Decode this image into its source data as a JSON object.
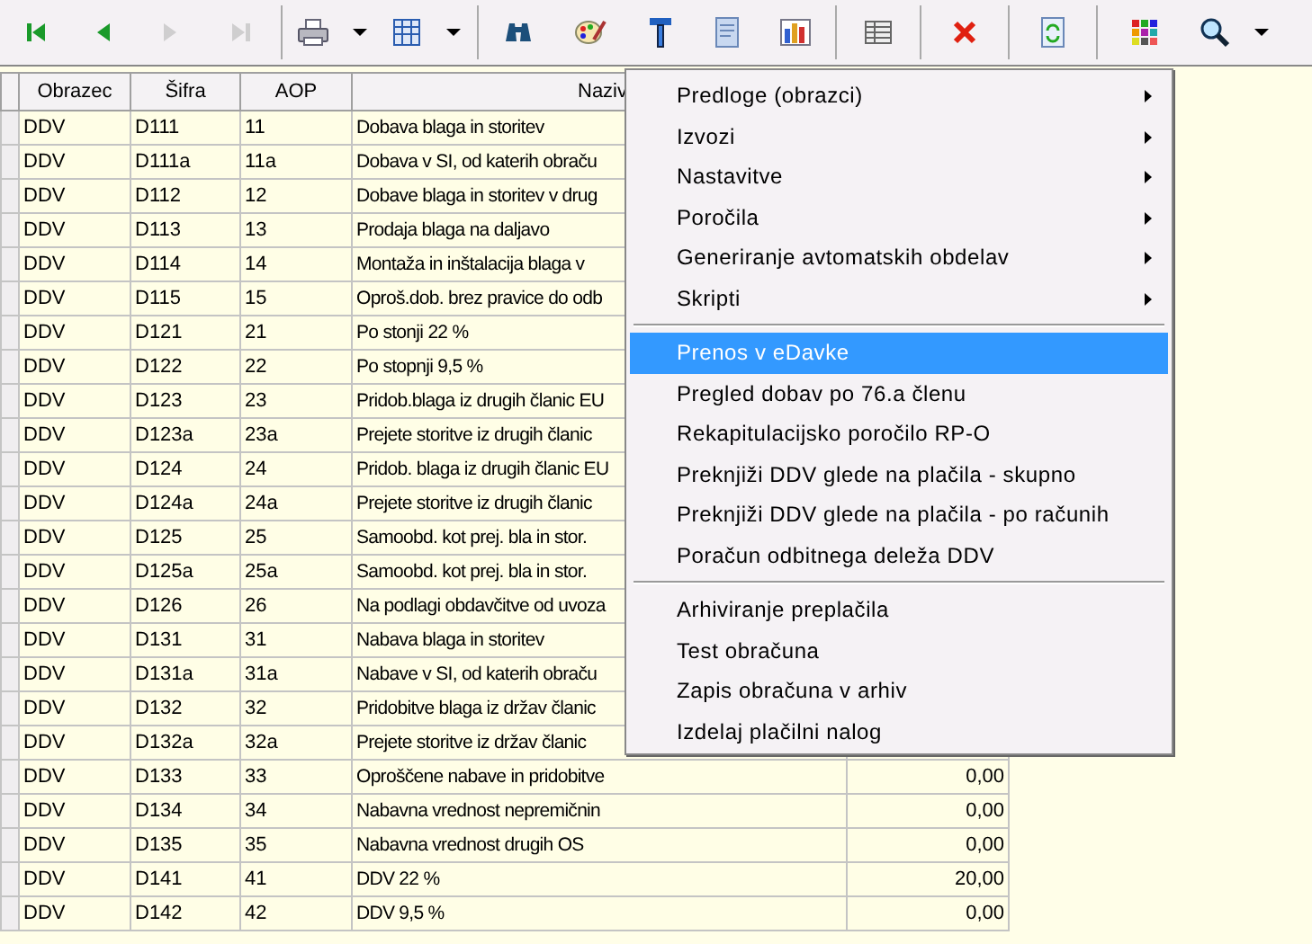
{
  "toolbar": {
    "buttons": [
      {
        "disabled": false
      },
      {
        "disabled": false
      },
      {
        "disabled": true
      },
      {
        "disabled": true
      },
      {
        "disabled": false
      },
      {
        "disabled": false
      },
      {
        "disabled": false
      },
      {
        "disabled": false
      },
      {
        "disabled": false
      },
      {
        "disabled": false
      },
      {
        "disabled": false
      },
      {
        "disabled": false
      },
      {
        "disabled": false
      },
      {
        "disabled": false
      },
      {
        "disabled": false
      },
      {
        "disabled": false
      }
    ]
  },
  "table": {
    "columns": [
      "Obrazec",
      "Šifra",
      "AOP",
      "Naziv"
    ],
    "rows": [
      {
        "cells": [
          "DDV",
          "D111",
          "11",
          "Dobava blaga in storitev"
        ]
      },
      {
        "cells": [
          "DDV",
          "D111a",
          "11a",
          "Dobava v SI, od katerih obraču"
        ]
      },
      {
        "cells": [
          "DDV",
          "D112",
          "12",
          "Dobave blaga in storitev v drug"
        ]
      },
      {
        "cells": [
          "DDV",
          "D113",
          "13",
          "Prodaja blaga na daljavo"
        ]
      },
      {
        "cells": [
          "DDV",
          "D114",
          "14",
          "Montaža in inštalacija blaga v"
        ]
      },
      {
        "cells": [
          "DDV",
          "D115",
          "15",
          "Oproš.dob. brez pravice do odb"
        ]
      },
      {
        "cells": [
          "DDV",
          "D121",
          "21",
          "Po stonji 22 %"
        ]
      },
      {
        "cells": [
          "DDV",
          "D122",
          "22",
          "Po stopnji 9,5 %"
        ]
      },
      {
        "cells": [
          "DDV",
          "D123",
          "23",
          "Pridob.blaga iz drugih članic EU"
        ]
      },
      {
        "cells": [
          "DDV",
          "D123a",
          "23a",
          "Prejete storitve iz drugih članic"
        ]
      },
      {
        "cells": [
          "DDV",
          "D124",
          "24",
          "Pridob. blaga iz drugih članic EU"
        ]
      },
      {
        "cells": [
          "DDV",
          "D124a",
          "24a",
          "Prejete storitve iz drugih članic"
        ]
      },
      {
        "cells": [
          "DDV",
          "D125",
          "25",
          "Samoobd. kot prej. bla in stor."
        ]
      },
      {
        "cells": [
          "DDV",
          "D125a",
          "25a",
          "Samoobd. kot prej. bla in stor."
        ]
      },
      {
        "cells": [
          "DDV",
          "D126",
          "26",
          "Na podlagi obdavčitve od uvoza"
        ]
      },
      {
        "cells": [
          "DDV",
          "D131",
          "31",
          "Nabava blaga in storitev"
        ]
      },
      {
        "cells": [
          "DDV",
          "D131a",
          "31a",
          "Nabave v SI, od katerih obraču"
        ]
      },
      {
        "cells": [
          "DDV",
          "D132",
          "32",
          "Pridobitve blaga iz držav članic"
        ]
      },
      {
        "cells": [
          "DDV",
          "D132a",
          "32a",
          "Prejete storitve iz držav članic"
        ]
      },
      {
        "cells": [
          "DDV",
          "D133",
          "33",
          "Oproščene nabave in pridobitve"
        ],
        "value": "0,00"
      },
      {
        "cells": [
          "DDV",
          "D134",
          "34",
          "Nabavna vrednost nepremičnin"
        ],
        "value": "0,00"
      },
      {
        "cells": [
          "DDV",
          "D135",
          "35",
          "Nabavna vrednost drugih OS"
        ],
        "value": "0,00"
      },
      {
        "cells": [
          "DDV",
          "D141",
          "41",
          "DDV 22 %"
        ],
        "value": "20,00"
      },
      {
        "cells": [
          "DDV",
          "D142",
          "42",
          "DDV 9,5 %"
        ],
        "value": "0,00"
      }
    ]
  },
  "context_menu": {
    "groups": [
      [
        {
          "label": "Predloge (obrazci)",
          "submenu": true,
          "selected": false
        },
        {
          "label": "Izvozi",
          "submenu": true,
          "selected": false
        },
        {
          "label": "Nastavitve",
          "submenu": true,
          "selected": false
        },
        {
          "label": "Poročila",
          "submenu": true,
          "selected": false
        },
        {
          "label": "Generiranje avtomatskih obdelav",
          "submenu": true,
          "selected": false
        },
        {
          "label": "Skripti",
          "submenu": true,
          "selected": false
        }
      ],
      [
        {
          "label": "Prenos v eDavke",
          "submenu": false,
          "selected": true
        },
        {
          "label": "Pregled dobav po 76.a členu",
          "submenu": false,
          "selected": false
        },
        {
          "label": "Rekapitulacijsko poročilo RP-O",
          "submenu": false,
          "selected": false
        },
        {
          "label": "Preknjiži DDV glede na plačila - skupno",
          "submenu": false,
          "selected": false
        },
        {
          "label": "Preknjiži DDV glede na plačila - po računih",
          "submenu": false,
          "selected": false
        },
        {
          "label": "Poračun odbitnega deleža DDV",
          "submenu": false,
          "selected": false
        }
      ],
      [
        {
          "label": "Arhiviranje preplačila",
          "submenu": false,
          "selected": false
        },
        {
          "label": "Test obračuna",
          "submenu": false,
          "selected": false
        },
        {
          "label": "Zapis obračuna v arhiv",
          "submenu": false,
          "selected": false
        },
        {
          "label": "Izdelaj plačilni nalog",
          "submenu": false,
          "selected": false
        }
      ]
    ]
  }
}
